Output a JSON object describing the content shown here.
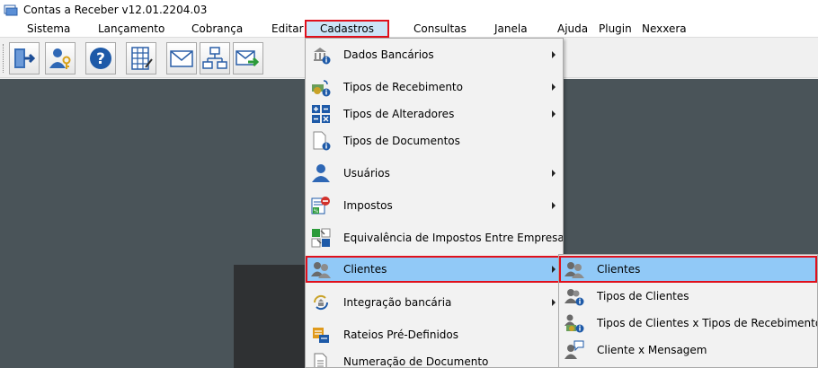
{
  "window": {
    "title": "Contas a Receber v12.01.2204.03"
  },
  "menubar": {
    "items": [
      {
        "label": "Sistema"
      },
      {
        "label": "Lançamento"
      },
      {
        "label": "Cobrança"
      },
      {
        "label": "Editar"
      },
      {
        "label": "Cadastros",
        "active": true
      },
      {
        "label": "Consultas"
      },
      {
        "label": "Janela"
      },
      {
        "label": "Ajuda"
      },
      {
        "label": "Plugin"
      },
      {
        "label": "Nexxera"
      }
    ]
  },
  "toolbar": {
    "buttons": [
      {
        "icon": "exit-door-icon"
      },
      {
        "icon": "user-key-icon"
      },
      {
        "icon": "help-icon"
      },
      {
        "icon": "spreadsheet-icon"
      },
      {
        "icon": "envelope-icon"
      },
      {
        "icon": "network-icon"
      },
      {
        "icon": "send-mail-icon"
      }
    ]
  },
  "dropdown": {
    "items": [
      {
        "label": "Dados Bancários",
        "icon": "bank-info-icon",
        "submenu": true
      },
      {
        "label": "Tipos de Recebimento",
        "icon": "receipt-types-icon",
        "submenu": true
      },
      {
        "label": "Tipos de Alteradores",
        "icon": "calculator-icon",
        "submenu": true
      },
      {
        "label": "Tipos de Documentos",
        "icon": "document-info-icon",
        "submenu": false
      },
      {
        "label": "Usuários",
        "icon": "user-icon",
        "submenu": true
      },
      {
        "label": "Impostos",
        "icon": "tax-icon",
        "submenu": true
      },
      {
        "label": "Equivalência de Impostos Entre Empresas",
        "icon": "tax-equivalence-icon",
        "submenu": false
      },
      {
        "label": "Clientes",
        "icon": "clients-icon",
        "submenu": true,
        "highlight": true
      },
      {
        "label": "Integração bancária",
        "icon": "bank-integration-icon",
        "submenu": true
      },
      {
        "label": "Rateios Pré-Definidos",
        "icon": "apportionment-icon",
        "submenu": false
      },
      {
        "label": "Numeração de Documento",
        "icon": "document-numbering-icon",
        "submenu": false
      }
    ]
  },
  "submenu": {
    "items": [
      {
        "label": "Clientes",
        "icon": "clients-icon",
        "highlight": true
      },
      {
        "label": "Tipos de Clientes",
        "icon": "client-types-icon"
      },
      {
        "label": "Tipos de Clientes x Tipos de Recebimento",
        "icon": "client-receipt-types-icon"
      },
      {
        "label": "Cliente x Mensagem",
        "icon": "client-message-icon"
      }
    ]
  },
  "colors": {
    "highlight": "#91c9f7",
    "focus_outline": "#e0101c",
    "workspace": "#4a5459",
    "active_menu": "#cce4f7"
  }
}
